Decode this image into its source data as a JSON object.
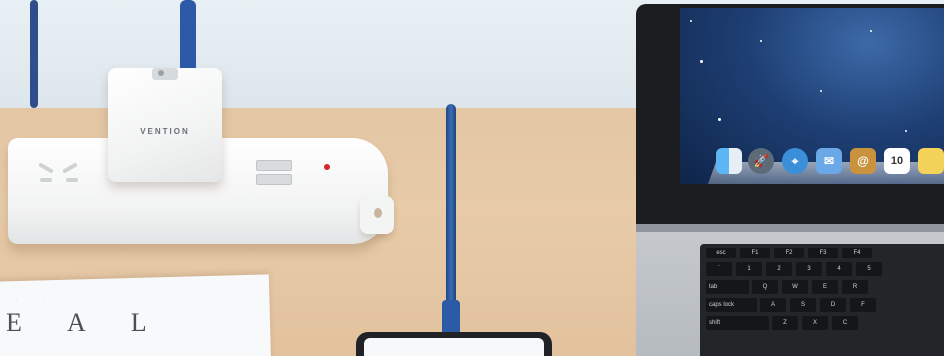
{
  "photo": {
    "charger_brand": "VENTION",
    "paper_text": "E A L",
    "calendar_day": "10",
    "keyboard_labels": {
      "tab": "tab",
      "caps": "caps lock",
      "shift": "shift",
      "row_top": [
        "esc",
        "F1",
        "F2",
        "F3",
        "F4"
      ],
      "row_num": [
        "`",
        "1",
        "2",
        "3",
        "4",
        "5"
      ],
      "row_q": [
        "Q",
        "W",
        "E",
        "R"
      ],
      "row_a": [
        "A",
        "S",
        "D",
        "F"
      ],
      "row_z": [
        "Z",
        "X",
        "C"
      ]
    }
  },
  "dock_icons": [
    "finder-icon",
    "launchpad-icon",
    "safari-icon",
    "mail-icon",
    "contacts-icon",
    "calendar-icon",
    "notes-icon"
  ]
}
